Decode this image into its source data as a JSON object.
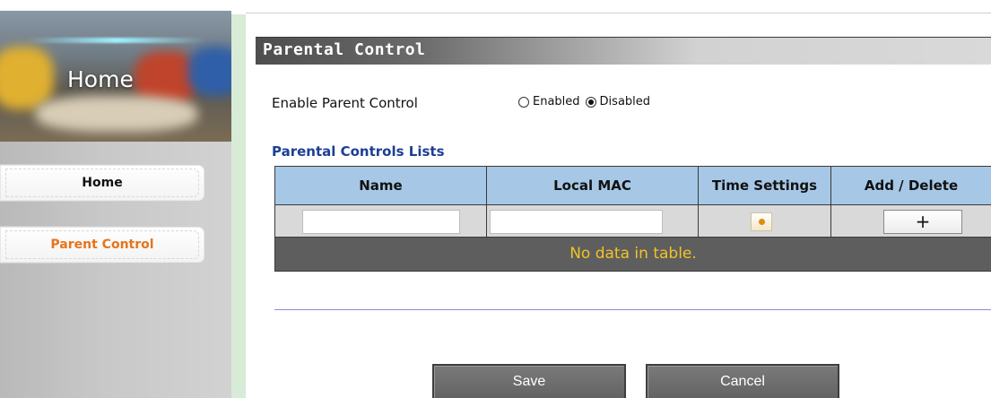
{
  "sidebar": {
    "banner_title": "Home",
    "items": [
      {
        "label": "Home",
        "color": "#111111"
      },
      {
        "label": "Parent Control",
        "color": "#e8731a"
      }
    ]
  },
  "page": {
    "title": "Parental Control",
    "enable_label": "Enable Parent Control",
    "radio_options": [
      {
        "label": "Enabled",
        "checked": false
      },
      {
        "label": "Disabled",
        "checked": true
      }
    ],
    "lists_heading": "Parental Controls Lists"
  },
  "table": {
    "headers": [
      "Name",
      "Local MAC",
      "Time Settings",
      "Add / Delete"
    ],
    "input_row": {
      "name_value": "",
      "mac_value": "",
      "time_icon": "clock-icon",
      "add_label": "+"
    },
    "empty_message": "No data in table."
  },
  "buttons": {
    "save": "Save",
    "cancel": "Cancel"
  },
  "colors": {
    "header_bg": "#a6c8e6",
    "heading_blue": "#1c3f94",
    "empty_text": "#f0c328",
    "empty_bg": "#5e5e5e",
    "active_menu": "#e8731a"
  }
}
